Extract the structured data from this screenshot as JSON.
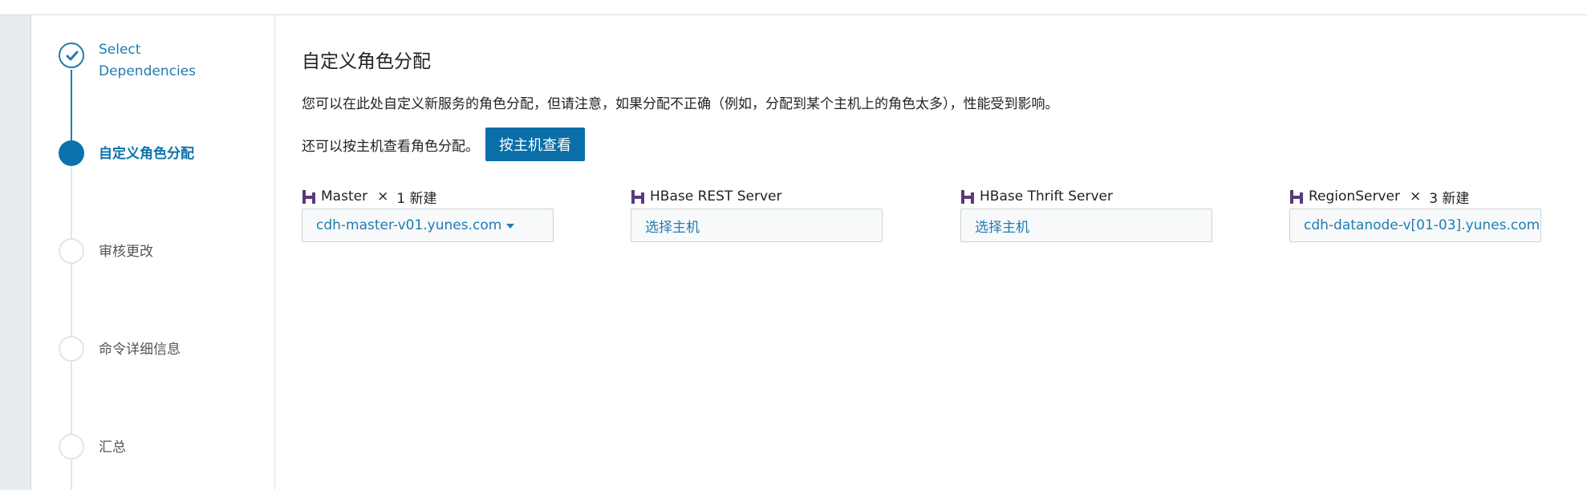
{
  "steps": [
    {
      "label": "Select Dependencies",
      "line1": "Select",
      "line2": "Dependencies",
      "state": "done"
    },
    {
      "label": "自定义角色分配",
      "state": "active"
    },
    {
      "label": "审核更改",
      "state": "pending"
    },
    {
      "label": "命令详细信息",
      "state": "pending"
    },
    {
      "label": "汇总",
      "state": "pending"
    }
  ],
  "main": {
    "title": "自定义角色分配",
    "description": "您可以在此处自定义新服务的角色分配，但请注意，如果分配不正确（例如，分配到某个主机上的角色太多），性能受到影响。",
    "view_text": "还可以按主机查看角色分配。",
    "view_button": "按主机查看"
  },
  "roles": [
    {
      "name": "Master",
      "multiplier": "×",
      "count": "1 新建",
      "host": "cdh-master-v01.yunes.com",
      "has_caret": true
    },
    {
      "name": "HBase REST Server",
      "host": "选择主机"
    },
    {
      "name": "HBase Thrift Server",
      "host": "选择主机"
    },
    {
      "name": "RegionServer",
      "multiplier": "×",
      "count": "3 新建",
      "host": "cdh-datanode-v[01-03].yunes.com."
    }
  ],
  "colors": {
    "accent": "#0b72ad",
    "link": "#1f7cb2",
    "hbase_icon": "#5b3a7a"
  },
  "icons": {
    "done_step": "check-icon",
    "role": "hbase-icon",
    "dropdown": "caret-down-icon"
  }
}
